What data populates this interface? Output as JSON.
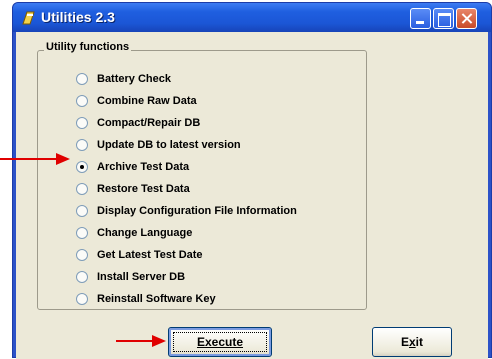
{
  "window": {
    "title": "Utilities 2.3"
  },
  "group": {
    "label": "Utility functions"
  },
  "options": [
    {
      "label": "Battery Check",
      "checked": false
    },
    {
      "label": "Combine Raw Data",
      "checked": false
    },
    {
      "label": "Compact/Repair DB",
      "checked": false
    },
    {
      "label": "Update DB to latest version",
      "checked": false
    },
    {
      "label": "Archive Test Data",
      "checked": true
    },
    {
      "label": "Restore Test Data",
      "checked": false
    },
    {
      "label": "Display Configuration File Information",
      "checked": false
    },
    {
      "label": "Change Language",
      "checked": false
    },
    {
      "label": "Get Latest Test Date",
      "checked": false
    },
    {
      "label": "Install Server DB",
      "checked": false
    },
    {
      "label": "Reinstall Software Key",
      "checked": false
    }
  ],
  "buttons": {
    "execute": "Execute",
    "exit_prefix": "E",
    "exit_mnemonic": "x",
    "exit_suffix": "it"
  },
  "colors": {
    "arrow": "#e00000",
    "titlebar": "#1f5fe0",
    "client": "#ece9d8"
  }
}
